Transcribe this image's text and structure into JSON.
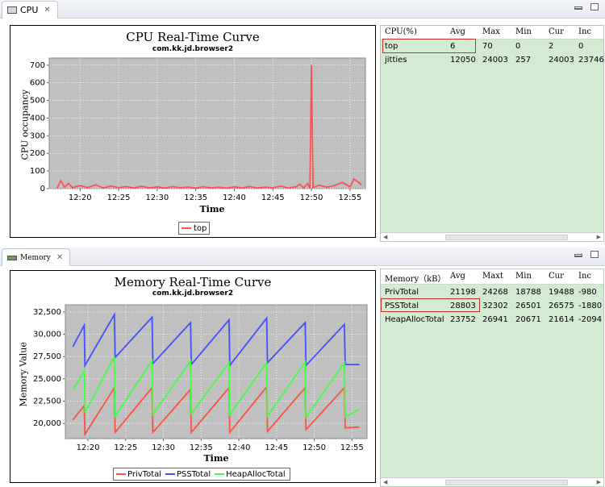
{
  "cpu_panel": {
    "tab_label": "CPU",
    "chart": {
      "title": "CPU Real-Time Curve",
      "subtitle": "com.kk.jd.browser2",
      "xlabel": "Time",
      "ylabel": "CPU occupancy",
      "legend": [
        "top"
      ]
    },
    "table": {
      "headers": [
        "CPU(%)",
        "Avg",
        "Max",
        "Min",
        "Cur",
        "Inc"
      ],
      "rows": [
        [
          "top",
          "6",
          "70",
          "0",
          "2",
          "0"
        ],
        [
          "jitties",
          "12050",
          "24003",
          "257",
          "24003",
          "23746"
        ]
      ]
    }
  },
  "memory_panel": {
    "tab_label": "Memory",
    "chart": {
      "title": "Memory Real-Time Curve",
      "subtitle": "com.kk.jd.browser2",
      "xlabel": "Time",
      "ylabel": "Memory Value",
      "legend": [
        "PrivTotal",
        "PSSTotal",
        "HeapAllocTotal"
      ]
    },
    "table": {
      "headers": [
        "Memory（kB）",
        "Avg",
        "Maxt",
        "Min",
        "Cur",
        "Inc"
      ],
      "rows": [
        [
          "PrivTotal",
          "21198",
          "24268",
          "18788",
          "19488",
          "-980"
        ],
        [
          "PSSTotal",
          "28803",
          "32302",
          "26501",
          "26575",
          "-1880"
        ],
        [
          "HeapAllocTotal",
          "23752",
          "26941",
          "20671",
          "21614",
          "-2094"
        ]
      ]
    }
  },
  "chart_data": [
    {
      "type": "line",
      "title": "CPU Real-Time Curve",
      "subtitle": "com.kk.jd.browser2",
      "xlabel": "Time",
      "ylabel": "CPU occupancy",
      "x_ticks": [
        "12:20",
        "12:25",
        "12:30",
        "12:35",
        "12:40",
        "12:45",
        "12:50",
        "12:55"
      ],
      "x_range": [
        "12:16",
        "12:57"
      ],
      "y_ticks": [
        0,
        100,
        200,
        300,
        400,
        500,
        600,
        700
      ],
      "ylim": [
        0,
        740
      ],
      "grid": true,
      "legend_position": "bottom",
      "series": [
        {
          "name": "top",
          "color": "#ff5050",
          "points": [
            [
              "12:17",
              2
            ],
            [
              "12:17.5",
              45
            ],
            [
              "12:18",
              8
            ],
            [
              "12:18.5",
              30
            ],
            [
              "12:19",
              5
            ],
            [
              "12:20",
              18
            ],
            [
              "12:21",
              6
            ],
            [
              "12:22",
              22
            ],
            [
              "12:23",
              4
            ],
            [
              "12:24",
              15
            ],
            [
              "12:25",
              6
            ],
            [
              "12:26",
              12
            ],
            [
              "12:27",
              3
            ],
            [
              "12:28",
              14
            ],
            [
              "12:29",
              4
            ],
            [
              "12:30",
              10
            ],
            [
              "12:31",
              3
            ],
            [
              "12:32",
              12
            ],
            [
              "12:33",
              5
            ],
            [
              "12:34",
              9
            ],
            [
              "12:35",
              3
            ],
            [
              "12:36",
              11
            ],
            [
              "12:37",
              4
            ],
            [
              "12:38",
              8
            ],
            [
              "12:39",
              3
            ],
            [
              "12:40",
              10
            ],
            [
              "12:41",
              4
            ],
            [
              "12:42",
              12
            ],
            [
              "12:43",
              3
            ],
            [
              "12:44",
              9
            ],
            [
              "12:45",
              5
            ],
            [
              "12:46",
              14
            ],
            [
              "12:47",
              4
            ],
            [
              "12:48",
              11
            ],
            [
              "12:48.5",
              25
            ],
            [
              "12:49",
              5
            ],
            [
              "12:49.5",
              30
            ],
            [
              "12:49.8",
              0
            ],
            [
              "12:50",
              700
            ],
            [
              "12:50.2",
              5
            ],
            [
              "12:51",
              20
            ],
            [
              "12:52",
              8
            ],
            [
              "12:53",
              18
            ],
            [
              "12:54",
              35
            ],
            [
              "12:55",
              10
            ],
            [
              "12:55.5",
              55
            ],
            [
              "12:56",
              40
            ],
            [
              "12:56.5",
              20
            ]
          ]
        }
      ]
    },
    {
      "type": "line",
      "title": "Memory Real-Time Curve",
      "subtitle": "com.kk.jd.browser2",
      "xlabel": "Time",
      "ylabel": "Memory Value",
      "x_ticks": [
        "12:20",
        "12:25",
        "12:30",
        "12:35",
        "12:40",
        "12:45",
        "12:50",
        "12:55"
      ],
      "x_range": [
        "12:17",
        "12:57"
      ],
      "y_ticks": [
        20000,
        22500,
        25000,
        27500,
        30000,
        32500
      ],
      "y_tick_labels": [
        "20,000",
        "22,500",
        "25,000",
        "27,500",
        "30,000",
        "32,500"
      ],
      "ylim": [
        18300,
        33300
      ],
      "grid": true,
      "legend_position": "bottom",
      "series": [
        {
          "name": "PrivTotal",
          "color": "#ff5040",
          "points": [
            [
              "12:18",
              20400
            ],
            [
              "12:19.5",
              22000
            ],
            [
              "12:19.6",
              18800
            ],
            [
              "12:23.5",
              24000
            ],
            [
              "12:23.6",
              19000
            ],
            [
              "12:28.5",
              24000
            ],
            [
              "12:28.6",
              19000
            ],
            [
              "12:33.6",
              23800
            ],
            [
              "12:33.7",
              19000
            ],
            [
              "12:38.7",
              24000
            ],
            [
              "12:38.8",
              19000
            ],
            [
              "12:43.7",
              24100
            ],
            [
              "12:43.8",
              19100
            ],
            [
              "12:48.8",
              24000
            ],
            [
              "12:48.9",
              19300
            ],
            [
              "12:54",
              24000
            ],
            [
              "12:54.1",
              19500
            ],
            [
              "12:56",
              19600
            ]
          ]
        },
        {
          "name": "PSSTotal",
          "color": "#4050ff",
          "points": [
            [
              "12:18",
              28600
            ],
            [
              "12:19.5",
              31000
            ],
            [
              "12:19.6",
              26500
            ],
            [
              "12:23.5",
              32200
            ],
            [
              "12:23.6",
              27400
            ],
            [
              "12:28.5",
              31900
            ],
            [
              "12:28.6",
              26700
            ],
            [
              "12:33.6",
              31300
            ],
            [
              "12:33.7",
              26600
            ],
            [
              "12:38.7",
              31600
            ],
            [
              "12:38.8",
              26500
            ],
            [
              "12:43.7",
              31800
            ],
            [
              "12:43.8",
              26800
            ],
            [
              "12:48.8",
              31300
            ],
            [
              "12:48.9",
              26500
            ],
            [
              "12:54",
              31100
            ],
            [
              "12:54.1",
              26600
            ],
            [
              "12:56",
              26600
            ]
          ]
        },
        {
          "name": "HeapAllocTotal",
          "color": "#40ff40",
          "points": [
            [
              "12:18",
              23700
            ],
            [
              "12:19.5",
              25900
            ],
            [
              "12:19.6",
              21200
            ],
            [
              "12:23.5",
              27500
            ],
            [
              "12:23.6",
              20800
            ],
            [
              "12:28.5",
              27000
            ],
            [
              "12:28.6",
              21000
            ],
            [
              "12:33.6",
              27000
            ],
            [
              "12:33.7",
              21100
            ],
            [
              "12:38.7",
              26800
            ],
            [
              "12:38.8",
              21000
            ],
            [
              "12:43.7",
              26800
            ],
            [
              "12:43.8",
              20800
            ],
            [
              "12:48.8",
              26900
            ],
            [
              "12:48.9",
              20700
            ],
            [
              "12:54",
              26800
            ],
            [
              "12:54.1",
              20700
            ],
            [
              "12:56",
              21600
            ]
          ]
        }
      ]
    }
  ],
  "colors": {
    "table_bg": "#d3ebd1",
    "plot_bg": "#c0c0c0",
    "highlight_border": "#c93030"
  }
}
